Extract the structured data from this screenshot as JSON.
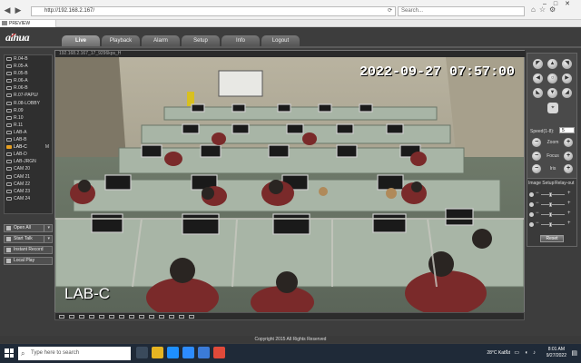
{
  "browser": {
    "url": "http://192.168.2.167/",
    "search_placeholder": "Search...",
    "tab_title": "PREVIEW"
  },
  "app": {
    "logo": "alhua",
    "nav": [
      "Live",
      "Playback",
      "Alarm",
      "Setup",
      "Info",
      "Logout"
    ],
    "active_nav": "Live",
    "channels": [
      {
        "label": "R.04-B",
        "m": ""
      },
      {
        "label": "R.05-A",
        "m": ""
      },
      {
        "label": "R.05-B",
        "m": ""
      },
      {
        "label": "R.06-A",
        "m": ""
      },
      {
        "label": "R.06-B",
        "m": ""
      },
      {
        "label": "R.07-PAPU/",
        "m": ""
      },
      {
        "label": "R.08-LOBBY",
        "m": ""
      },
      {
        "label": "R.09",
        "m": ""
      },
      {
        "label": "R.10",
        "m": ""
      },
      {
        "label": "R.11",
        "m": ""
      },
      {
        "label": "LAB-A",
        "m": ""
      },
      {
        "label": "LAB-B",
        "m": ""
      },
      {
        "label": "LAB-C",
        "m": "M"
      },
      {
        "label": "LAB-D",
        "m": ""
      },
      {
        "label": "LAB-JRGN",
        "m": ""
      },
      {
        "label": "CAM 20",
        "m": ""
      },
      {
        "label": "CAM 21",
        "m": ""
      },
      {
        "label": "CAM 22",
        "m": ""
      },
      {
        "label": "CAM 23",
        "m": ""
      },
      {
        "label": "CAM 24",
        "m": ""
      }
    ],
    "selected_channel": "LAB-C",
    "side_buttons": [
      "Open All",
      "Start Talk",
      "Instant Record",
      "Local Play"
    ],
    "video_title": "192.168.2.167_17_9296kps_H",
    "osd_timestamp": "2022-09-27  07:57:00",
    "osd_camera_name": "LAB-C",
    "ptz": {
      "speed_label": "Speed(1-8):",
      "speed_value": "5",
      "zoom": "Zoom",
      "focus": "Focus",
      "iris": "Iris"
    },
    "image_setup": {
      "tab1": "Image Setup",
      "tab2": "Relay-out",
      "sliders": [
        0.35,
        0.35,
        0.35,
        0.35
      ],
      "reset": "Reset"
    },
    "footer": "Copyright 2015 All Rights Reserved"
  },
  "taskbar": {
    "search_placeholder": "Type here to search",
    "weather": "28°C  Kabut",
    "time": "8:01 AM",
    "date": "9/27/2022"
  },
  "colors": {
    "app_bg": "#3d3d3d",
    "selected_channel": "#e8a020",
    "taskbar": "#1f2a38"
  }
}
